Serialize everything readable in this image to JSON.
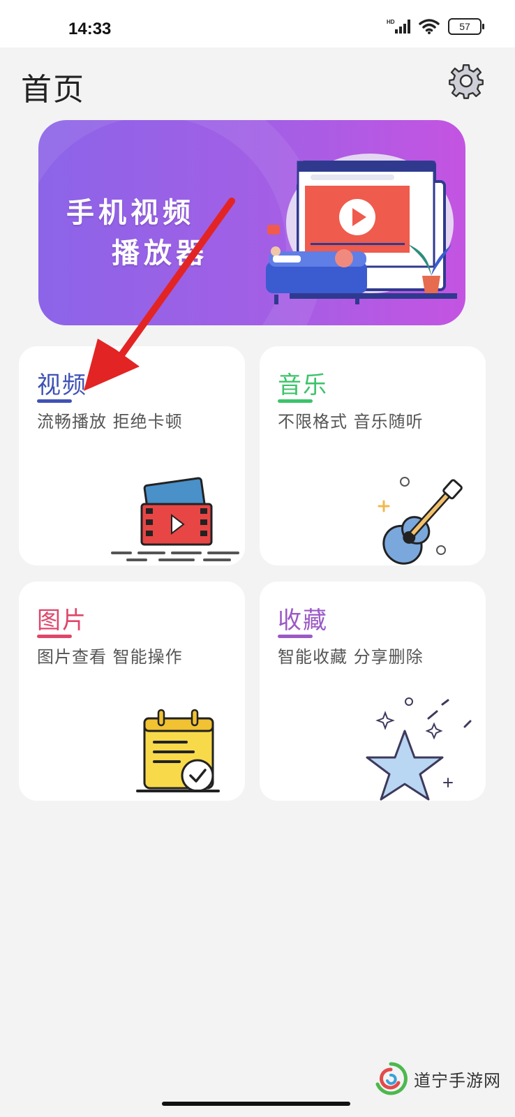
{
  "status_bar": {
    "time": "14:33",
    "network": "HD",
    "battery": "57"
  },
  "header": {
    "title": "首页",
    "settings_icon": "gear-icon"
  },
  "banner": {
    "line1": "手机视频",
    "line2": "播放器",
    "icon": "video-player-illustration"
  },
  "cards": [
    {
      "title": "视频",
      "subtitle": "流畅播放 拒绝卡顿",
      "accent": "#3f52b5",
      "icon": "film-video-icon"
    },
    {
      "title": "音乐",
      "subtitle": "不限格式 音乐随听",
      "accent": "#3cc36a",
      "icon": "guitar-icon"
    },
    {
      "title": "图片",
      "subtitle": "图片查看 智能操作",
      "accent": "#e0466a",
      "icon": "calendar-check-icon"
    },
    {
      "title": "收藏",
      "subtitle": "智能收藏 分享删除",
      "accent": "#9b59c6",
      "icon": "star-icon"
    }
  ],
  "watermark": {
    "text": "道宁手游网"
  },
  "colors": {
    "background": "#f3f3f4",
    "banner_start": "#8c64e8",
    "banner_end": "#c454e2",
    "arrow": "#e32424"
  }
}
